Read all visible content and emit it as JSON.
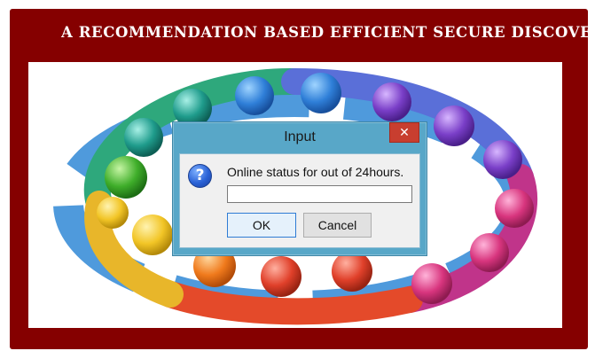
{
  "app": {
    "title": "A RECOMMENDATION BASED EFFICIENT SECURE DISCOVER-PREDICT-DE",
    "background_color": "#850000",
    "image_description_icon": "people-circle-image"
  },
  "dialog": {
    "title": "Input",
    "close_label": "✕",
    "icon": "question-icon",
    "icon_glyph": "?",
    "prompt": "Online status for out of 24hours.",
    "input_value": "",
    "ok_label": "OK",
    "cancel_label": "Cancel",
    "title_bar_color": "#58a7c8",
    "close_color": "#c83e2f"
  }
}
